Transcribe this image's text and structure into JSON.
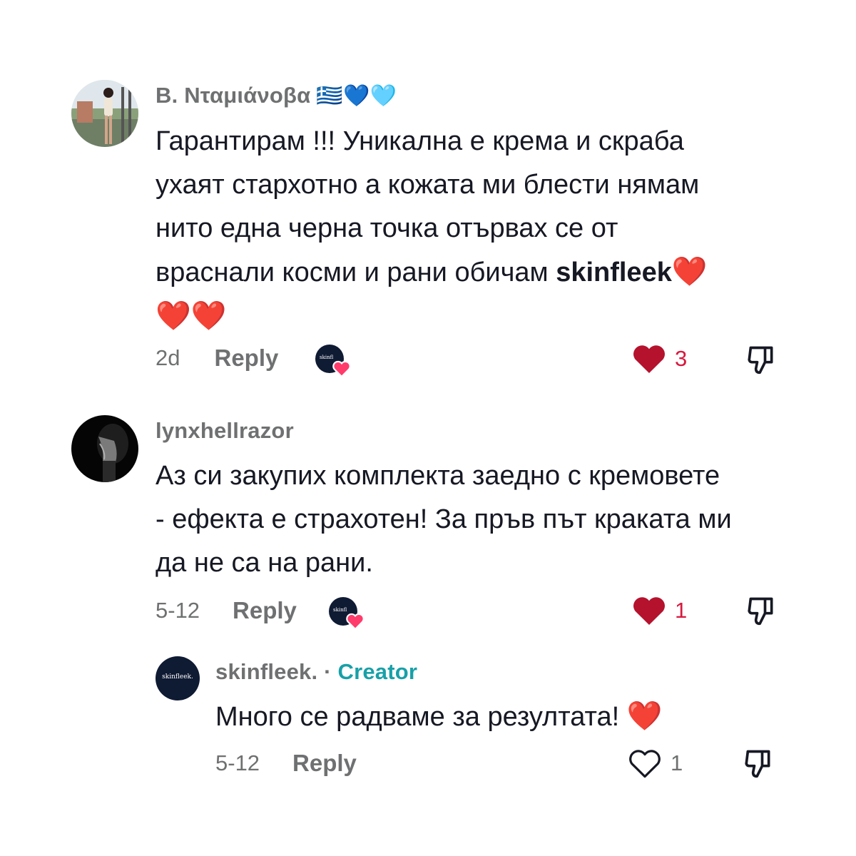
{
  "comments": [
    {
      "username": "Β. Νταμιάνοβα",
      "flags": "🇬🇷💙🩵",
      "lines": [
        "Гарантирам !!! Уникална е крема и скраба",
        "ухаят стархотно а кожата ми блести нямам",
        "нито една черна точка отървах се от"
      ],
      "line4_text": "враснали косми и рани обичам ",
      "line4_bold": "skinfleek",
      "line4_emoji": "❤️",
      "line5_emoji": "❤️❤️",
      "date": "2d",
      "reply_label": "Reply",
      "likes": "3",
      "liked_by_text": "skinfl"
    },
    {
      "username": "lynxhellrazor",
      "lines": [
        "Аз си закупих комплекта заедно с кремовете",
        "- ефекта е страхотен! За пръв път краката ми",
        "да не са на рани."
      ],
      "date": "5-12",
      "reply_label": "Reply",
      "likes": "1",
      "liked_by_text": "skinfl"
    }
  ],
  "reply": {
    "username": "skinfleek.",
    "separator": "·",
    "badge": "Creator",
    "avatar_text": "skinfleek.",
    "text": "Много се радваме за резултата!",
    "emoji": "❤️",
    "date": "5-12",
    "reply_label": "Reply",
    "likes": "1"
  },
  "colors": {
    "like_red": "#d7193f",
    "creator_teal": "#18a0a8",
    "meta_grey": "#6f7071",
    "brand_navy": "#0f1a33"
  }
}
